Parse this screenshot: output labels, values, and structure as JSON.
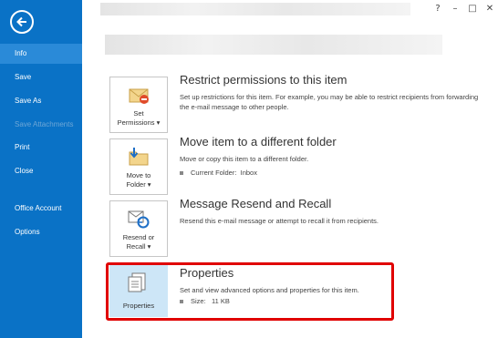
{
  "sidebar": {
    "items": [
      {
        "label": "Info"
      },
      {
        "label": "Save"
      },
      {
        "label": "Save As"
      },
      {
        "label": "Save Attachments"
      },
      {
        "label": "Print"
      },
      {
        "label": "Close"
      },
      {
        "label": "Office Account"
      },
      {
        "label": "Options"
      }
    ]
  },
  "window": {
    "help": "?",
    "minimize": "–",
    "restore": "□",
    "close": "✕"
  },
  "sections": {
    "permissions": {
      "button_line1": "Set",
      "button_line2": "Permissions ▾",
      "title": "Restrict permissions to this item",
      "description": "Set up restrictions for this item. For example, you may be able to restrict recipients from forwarding the e-mail message to other people."
    },
    "move": {
      "button_line1": "Move to",
      "button_line2": "Folder ▾",
      "title": "Move item to a different folder",
      "description": "Move or copy this item to a different folder.",
      "sub_label": "Current Folder:",
      "sub_value": "Inbox"
    },
    "resend": {
      "button_line1": "Resend or",
      "button_line2": "Recall ▾",
      "title": "Message Resend and Recall",
      "description": "Resend this e-mail message or attempt to recall it from recipients."
    },
    "properties": {
      "button_label": "Properties",
      "title": "Properties",
      "description": "Set and view advanced options and properties for this item.",
      "sub_label": "Size:",
      "sub_value": "11 KB"
    }
  }
}
